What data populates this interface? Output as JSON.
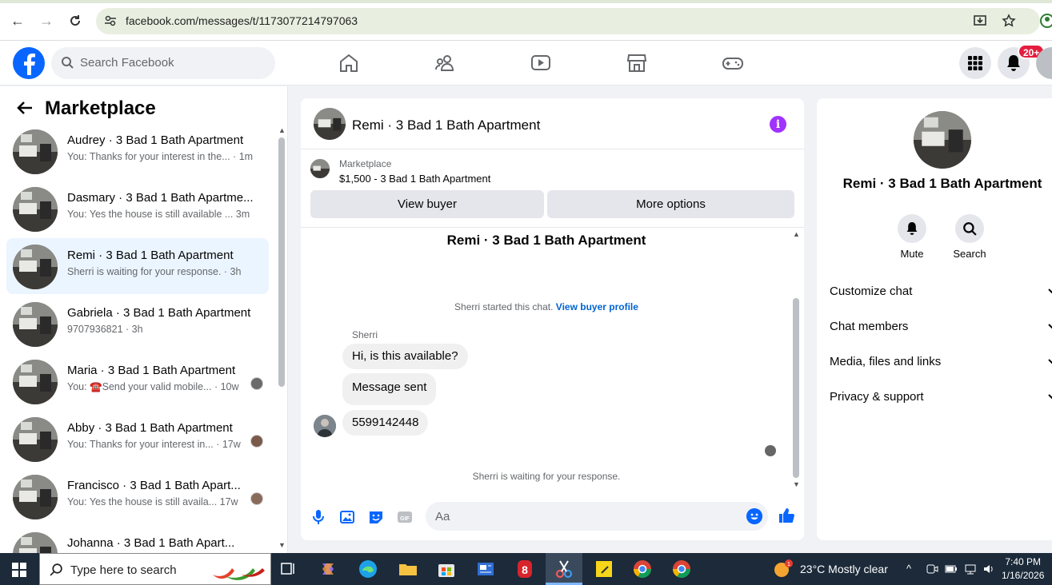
{
  "browser": {
    "url": "facebook.com/messages/t/1173077214797063"
  },
  "header": {
    "search_placeholder": "Search Facebook",
    "notification_badge": "20+"
  },
  "sidebar": {
    "title": "Marketplace",
    "conversations": [
      {
        "name": "Audrey · 3 Bad 1 Bath Apartment",
        "snippet": "You: Thanks for your interest in the... · 1m"
      },
      {
        "name": "Dasmary · 3 Bad 1 Bath Apartme...",
        "snippet": "You: Yes the house is still available ... 3m"
      },
      {
        "name": "Remi · 3 Bad 1 Bath Apartment",
        "snippet": "Sherri is waiting for your response. · 3h"
      },
      {
        "name": "Gabriela · 3 Bad 1 Bath Apartment",
        "snippet": "9707936821 · 3h"
      },
      {
        "name": "Maria · 3 Bad 1 Bath Apartment",
        "snippet": "You: ☎️Send your valid mobile... · 10w"
      },
      {
        "name": "Abby · 3 Bad 1 Bath Apartment",
        "snippet": "You: Thanks for your interest in... · 17w"
      },
      {
        "name": "Francisco · 3 Bad 1 Bath Apart...",
        "snippet": "You: Yes the house is still availa... 17w"
      },
      {
        "name": "Johanna · 3 Bad 1 Bath Apart...",
        "snippet": ""
      }
    ]
  },
  "chat": {
    "title": "Remi · 3 Bad 1 Bath Apartment",
    "marketplace_label": "Marketplace",
    "listing": "$1,500 - 3 Bad 1 Bath Apartment",
    "view_buyer": "View buyer",
    "more_options": "More options",
    "body_title": "Remi · 3 Bad 1 Bath Apartment",
    "started_text": "Sherri started this chat.",
    "view_buyer_profile": "View buyer profile",
    "sender": "Sherri",
    "messages": [
      "Hi, is this available?",
      "Message sent",
      "5599142448"
    ],
    "waiting_text": "Sherri is waiting for your response.",
    "composer_placeholder": "Aa"
  },
  "details": {
    "name": "Remi · 3 Bad 1 Bath Apartment",
    "mute": "Mute",
    "search": "Search",
    "sections": [
      "Customize chat",
      "Chat members",
      "Media, files and links",
      "Privacy & support"
    ]
  },
  "taskbar": {
    "search_placeholder": "Type here to search",
    "weather": "23°C  Mostly clear",
    "time": "7:40 PM",
    "date": "1/16/2026"
  },
  "colors": {
    "fb_blue": "#0866ff",
    "info_purple": "#a033ff",
    "active_conv": "#ebf5ff",
    "badge_red": "#e41e3f"
  }
}
